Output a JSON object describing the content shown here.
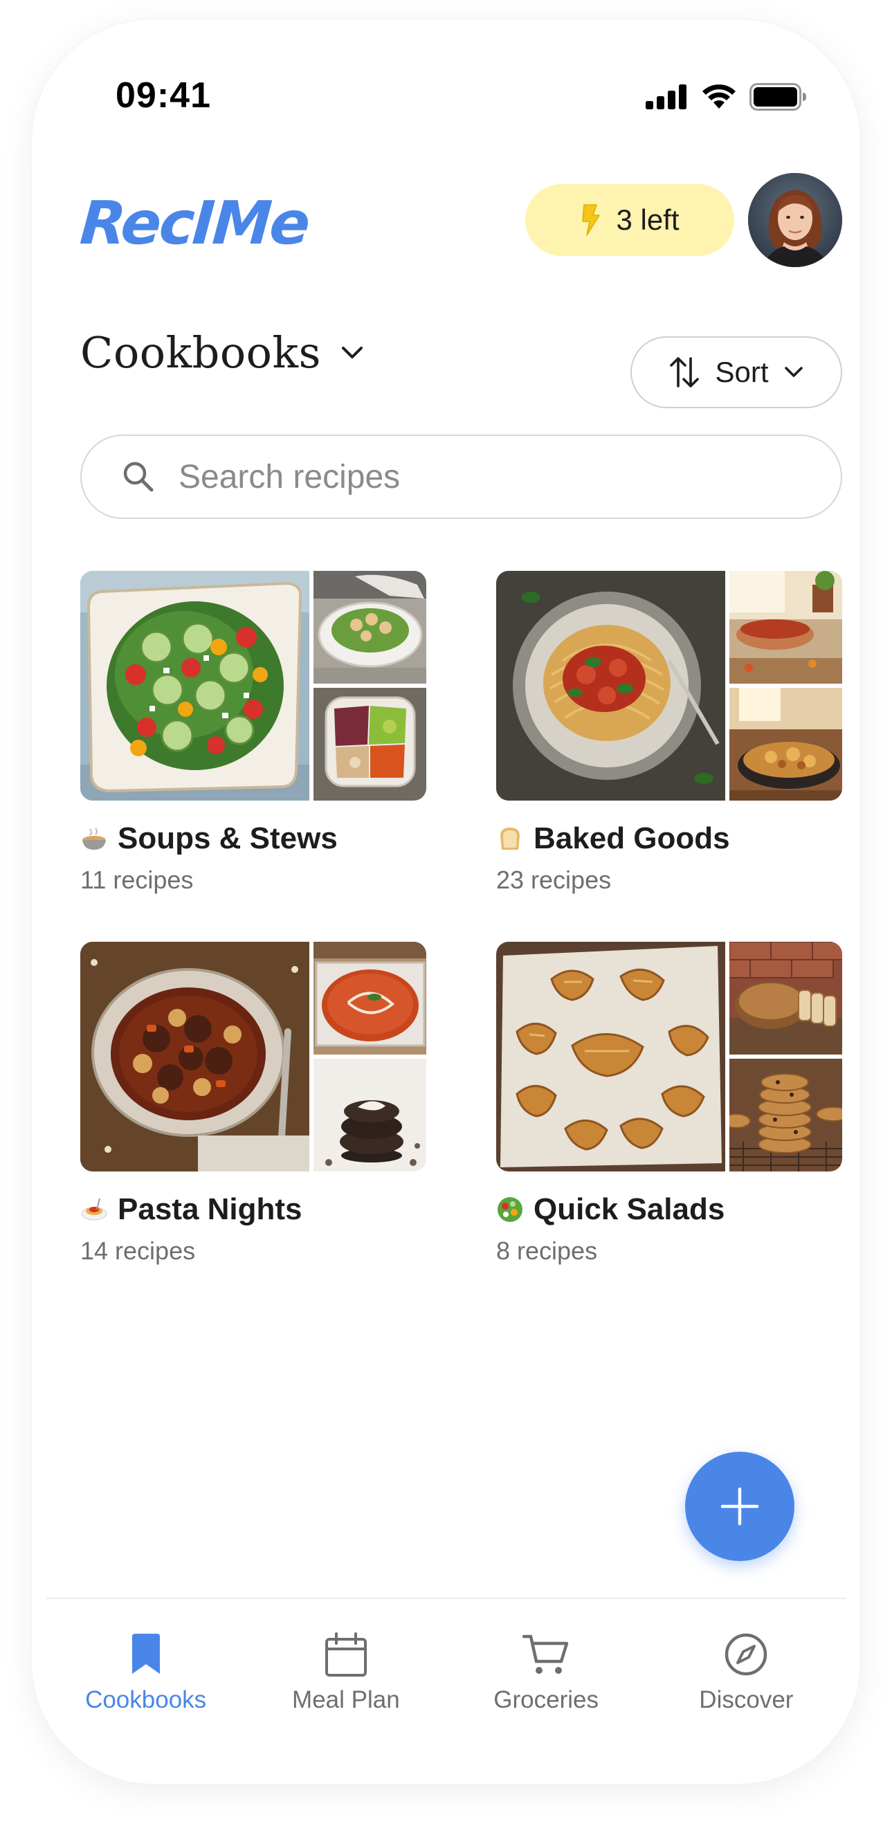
{
  "status_bar": {
    "time": "09:41"
  },
  "header": {
    "logo": "RecIMe",
    "credits_label": "3 left"
  },
  "section": {
    "title": "Cookbooks",
    "sort_label": "Sort"
  },
  "search": {
    "placeholder": "Search recipes"
  },
  "cookbooks": [
    {
      "name": "Soups & Stews",
      "count": "11 recipes",
      "emoji_icon": "soup-bowl-icon"
    },
    {
      "name": "Baked Goods",
      "count": "23 recipes",
      "emoji_icon": "bread-icon"
    },
    {
      "name": "Pasta Nights",
      "count": "14 recipes",
      "emoji_icon": "spaghetti-icon"
    },
    {
      "name": "Quick Salads",
      "count": "8 recipes",
      "emoji_icon": "salad-icon"
    }
  ],
  "tabs": [
    {
      "label": "Cookbooks",
      "icon": "bookmark-icon",
      "active": true
    },
    {
      "label": "Meal Plan",
      "icon": "calendar-icon",
      "active": false
    },
    {
      "label": "Groceries",
      "icon": "cart-icon",
      "active": false
    },
    {
      "label": "Discover",
      "icon": "compass-icon",
      "active": false
    }
  ],
  "colors": {
    "accent": "#4a86e8",
    "credits_bg": "#fff3b0",
    "credits_icon": "#f5c518",
    "muted_text": "#6e6e6b"
  }
}
